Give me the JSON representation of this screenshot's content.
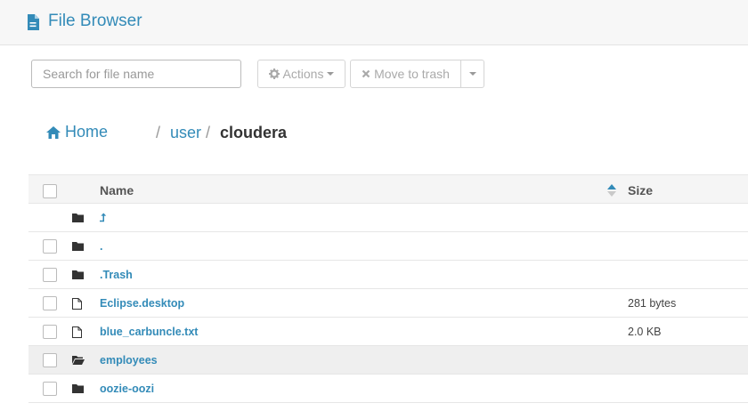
{
  "header": {
    "title": "File Browser",
    "icon": "document-icon"
  },
  "toolbar": {
    "search_placeholder": "Search for file name",
    "actions_label": "Actions",
    "trash_label": "Move to trash"
  },
  "breadcrumb": {
    "home": "Home",
    "separator": "/",
    "segments": [
      "user",
      "cloudera"
    ]
  },
  "table": {
    "columns": {
      "name": "Name",
      "size": "Size"
    },
    "sort": {
      "column": "Name",
      "direction": "ascending"
    },
    "rows": [
      {
        "name": "⮥",
        "size": "",
        "type": "folder",
        "selected": false,
        "checkbox": false
      },
      {
        "name": ".",
        "size": "",
        "type": "folder",
        "selected": false,
        "checkbox": true
      },
      {
        "name": ".Trash",
        "size": "",
        "type": "folder",
        "selected": false,
        "checkbox": true
      },
      {
        "name": "Eclipse.desktop",
        "size": "281 bytes",
        "type": "file",
        "selected": false,
        "checkbox": true
      },
      {
        "name": "blue_carbuncle.txt",
        "size": "2.0 KB",
        "type": "file",
        "selected": false,
        "checkbox": true
      },
      {
        "name": "employees",
        "size": "",
        "type": "folder-open",
        "selected": true,
        "checkbox": true
      },
      {
        "name": "oozie-oozi",
        "size": "",
        "type": "folder",
        "selected": false,
        "checkbox": true
      }
    ]
  },
  "colors": {
    "accent": "#338bb8",
    "header_bg": "#f7f7f7",
    "row_selected": "#efefef"
  }
}
